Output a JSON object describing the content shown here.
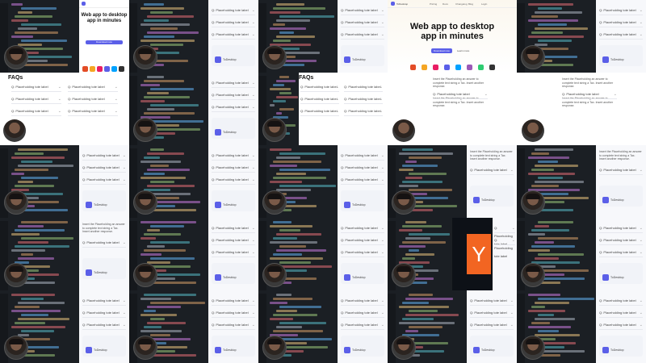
{
  "faq": {
    "title": "FAQs",
    "question": "Q: Placeholding tote label",
    "answer": "Insert the Placeholding an answer to complete text string a Tax. Insert another response."
  },
  "hero": {
    "title_line1": "Web app to desktop",
    "title_line2": "app in minutes",
    "title_small_line1": "Web app to desktop",
    "title_small_line2": "app in minutes",
    "cta": "Download now",
    "secondary": "Learn more"
  },
  "brand": {
    "name": "ToDesktop"
  },
  "nav": {
    "links": [
      "Pricing",
      "Docs",
      "Changelog",
      "Blog",
      "Login"
    ]
  },
  "footer": {
    "company": "ToDesktop"
  },
  "yc": {
    "letter": "Y"
  },
  "colors": {
    "accent": "#5b5fe8",
    "editor_bg": "#1b1f24",
    "yc_orange": "#f26522"
  }
}
